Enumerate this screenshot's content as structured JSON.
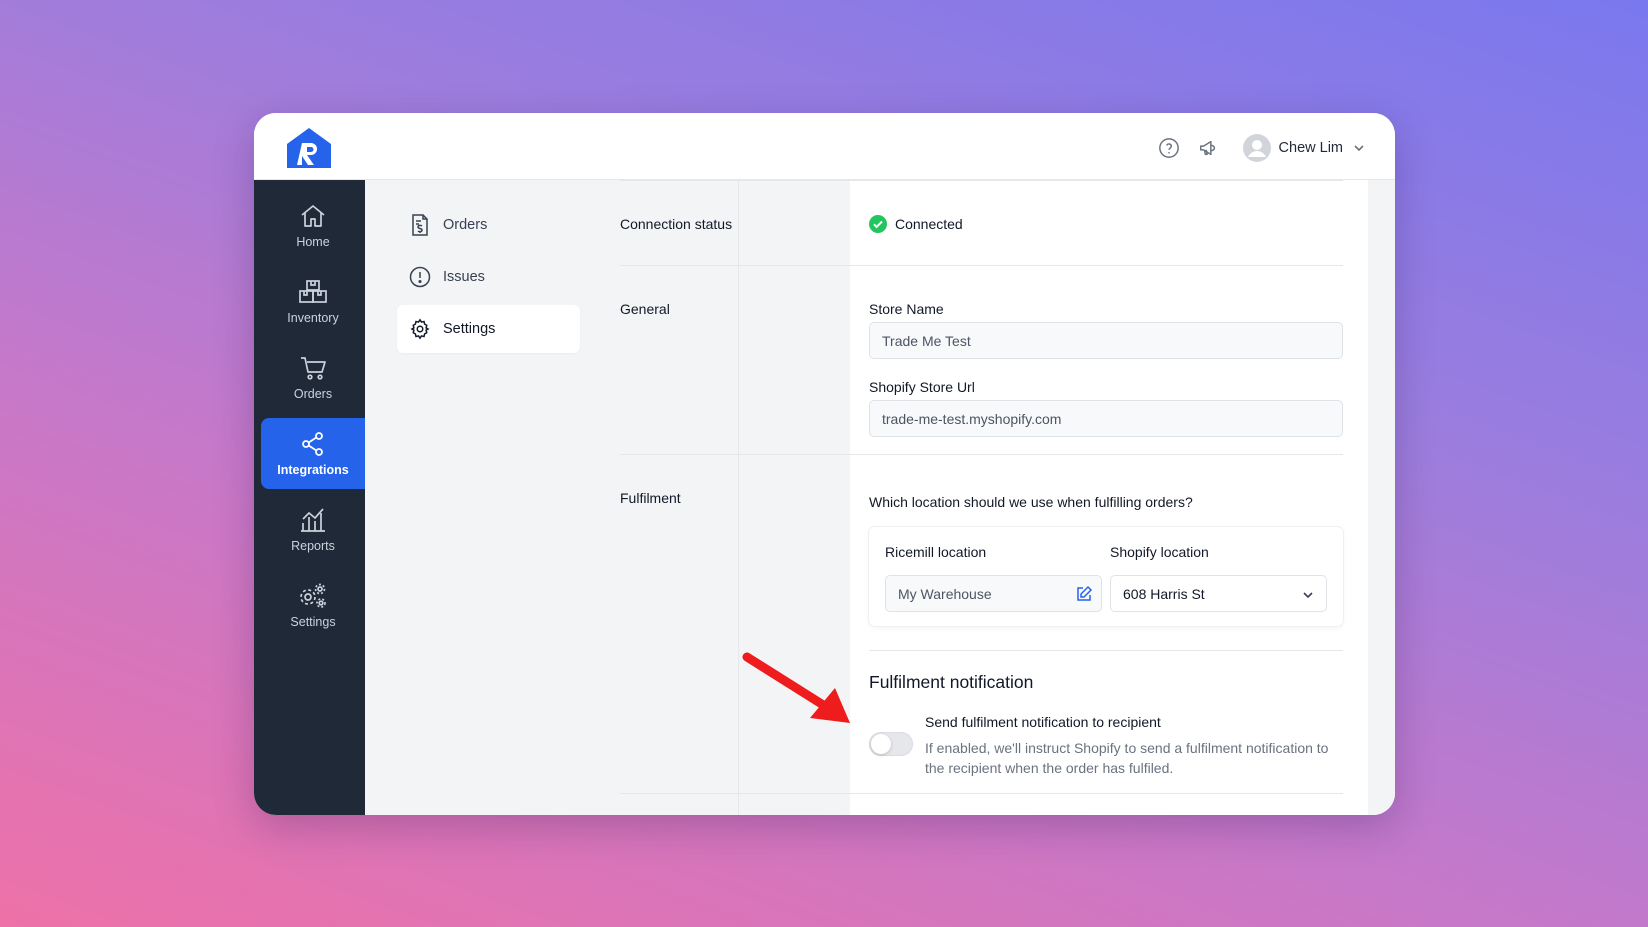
{
  "header": {
    "user_name": "Chew Lim",
    "icons": [
      "help-icon",
      "megaphone-icon",
      "user-avatar-icon",
      "chevron-down-icon"
    ]
  },
  "rail": {
    "items": [
      {
        "label": "Home",
        "icon": "home-icon"
      },
      {
        "label": "Inventory",
        "icon": "boxes-icon"
      },
      {
        "label": "Orders",
        "icon": "cart-icon"
      },
      {
        "label": "Integrations",
        "icon": "share-icon",
        "active": true
      },
      {
        "label": "Reports",
        "icon": "chart-icon"
      },
      {
        "label": "Settings",
        "icon": "gears-icon"
      }
    ]
  },
  "subnav": {
    "items": [
      {
        "label": "Orders",
        "icon": "receipt-icon"
      },
      {
        "label": "Issues",
        "icon": "alert-circle-icon"
      },
      {
        "label": "Settings",
        "icon": "gear-icon",
        "active": true
      }
    ]
  },
  "connection": {
    "label": "Connection status",
    "status": "Connected",
    "status_color": "#22c55e"
  },
  "general": {
    "label": "General",
    "store_name_label": "Store Name",
    "store_name_value": "Trade Me Test",
    "store_url_label": "Shopify Store Url",
    "store_url_value": "trade-me-test.myshopify.com"
  },
  "fulfilment": {
    "label": "Fulfilment",
    "question": "Which location should we use when fulfilling orders?",
    "ricemill_header": "Ricemill location",
    "shopify_header": "Shopify location",
    "ricemill_value": "My Warehouse",
    "shopify_value": "608 Harris St"
  },
  "notification": {
    "title": "Fulfilment notification",
    "toggle_label": "Send fulfilment notification to recipient",
    "toggle_on": false,
    "description": "If enabled, we'll instruct Shopify to send a fulfilment notification to the recipient when the order has fulfiled."
  },
  "colors": {
    "accent": "#2563eb",
    "rail_bg": "#1f2937",
    "annotation_arrow": "#ee1c1c"
  }
}
